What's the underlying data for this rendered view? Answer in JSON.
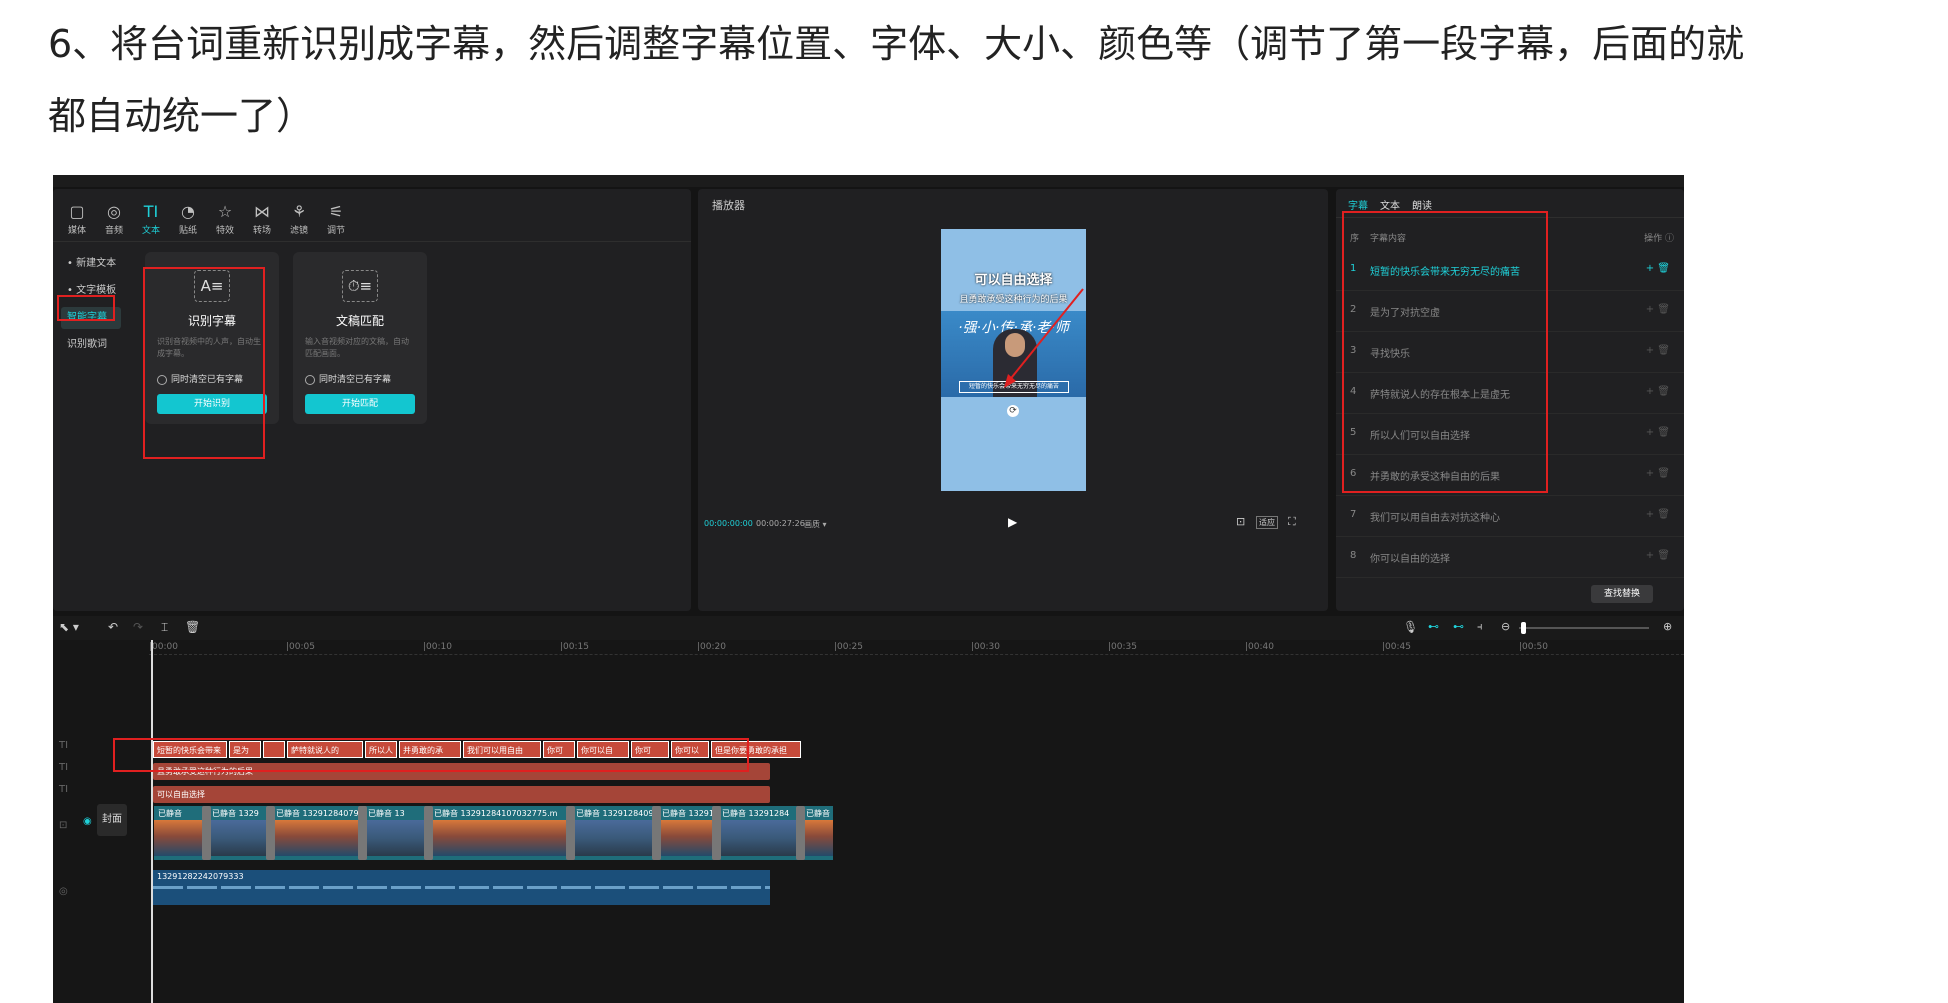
{
  "caption": {
    "line1": "6、将台词重新识别成字幕，然后调整字幕位置、字体、大小、颜色等（调节了第一段字幕，后面的就",
    "line2": "都自动统一了）"
  },
  "toolbar": [
    {
      "icon": "▢",
      "label": "媒体"
    },
    {
      "icon": "◎",
      "label": "音频"
    },
    {
      "icon": "TI",
      "label": "文本"
    },
    {
      "icon": "◔",
      "label": "贴纸"
    },
    {
      "icon": "☆",
      "label": "特效"
    },
    {
      "icon": "⋈",
      "label": "转场"
    },
    {
      "icon": "⚘",
      "label": "滤镜"
    },
    {
      "icon": "⚟",
      "label": "调节"
    }
  ],
  "text_sidebar": [
    "• 新建文本",
    "• 文字模板",
    "智能字幕",
    "识别歌词"
  ],
  "cards": {
    "recognize": {
      "icon": "A≡",
      "title": "识别字幕",
      "desc": "识别音视频中的人声，自动生成字幕。",
      "checkbox": "同时清空已有字幕",
      "button": "开始识别"
    },
    "match": {
      "icon": "⏱≡",
      "title": "文稿匹配",
      "desc": "输入音视频对应的文稿，自动匹配画面。",
      "checkbox": "同时清空已有字幕",
      "button": "开始匹配"
    }
  },
  "player": {
    "title": "播放器",
    "caption_line1": "可以自由选择",
    "caption_line2": "且勇敢承受这种行为的后果",
    "banner": "·强·小·传·承·老·师",
    "sub_on_video": "短暂的快乐会带来无穷无尽的痛苦",
    "time_current": "00:00:00:00",
    "time_total": "00:00:27:26",
    "quality": "画质 ▾",
    "ratio": "适应"
  },
  "subtitle_panel": {
    "tabs": [
      "字幕",
      "文本",
      "朗读"
    ],
    "col_index": "序",
    "col_content": "字幕内容",
    "col_ops": "操作 ⓘ",
    "rows": [
      {
        "n": "1",
        "text": "短暂的快乐会带来无穷无尽的痛苦"
      },
      {
        "n": "2",
        "text": "是为了对抗空虚"
      },
      {
        "n": "3",
        "text": "寻找快乐"
      },
      {
        "n": "4",
        "text": "萨特就说人的存在根本上是虚无"
      },
      {
        "n": "5",
        "text": "所以人们可以自由选择"
      },
      {
        "n": "6",
        "text": "并勇敢的承受这种自由的后果"
      },
      {
        "n": "7",
        "text": "我们可以用自由去对抗这种心"
      },
      {
        "n": "8",
        "text": "你可以自由的选择"
      }
    ],
    "find_replace": "查找替换"
  },
  "timeline": {
    "cover_label": "封面",
    "ruler": [
      "|00:00",
      "|00:05",
      "|00:10",
      "|00:15",
      "|00:20",
      "|00:25",
      "|00:30",
      "|00:35",
      "|00:40",
      "|00:45",
      "|00:50"
    ],
    "subtitle_chips": [
      "短暂的快乐会带来",
      "是为",
      "",
      "萨特就说人的",
      "所以人",
      "并勇敢的承",
      "我们可以用自由",
      "你可",
      "你可以自",
      "你可",
      "你可以",
      "但是你要勇敢的承担"
    ],
    "text_bar_1": "且勇敢承受这种行为的后果",
    "text_bar_2": "可以自由选择",
    "video_clips": [
      "已静音",
      "已静音  1329",
      "已静音  132912840792",
      "已静音  13",
      "已静音  13291284107032775.m",
      "已静音  132912840949",
      "已静音  1329128",
      "已静音  13291284",
      "已静音"
    ],
    "audio_label": "13291282242079333"
  }
}
